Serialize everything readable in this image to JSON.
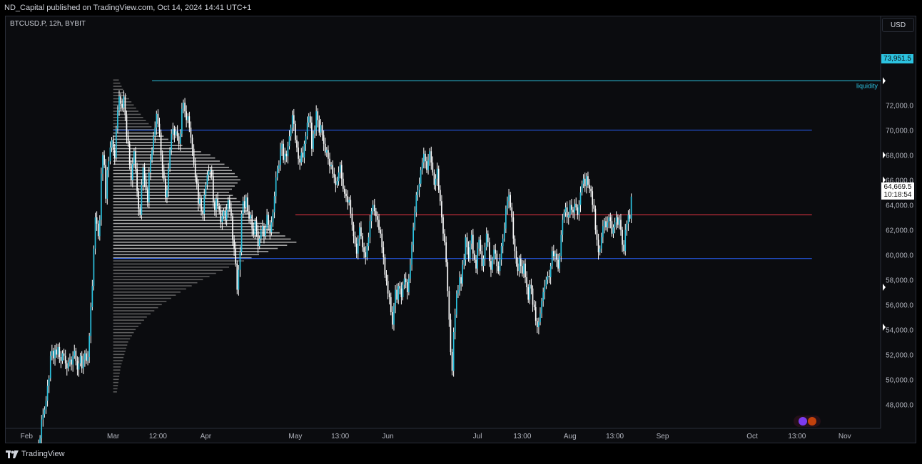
{
  "header": {
    "publish_info": "ND_Capital published on TradingView.com, Oct 14, 2024 14:41 UTC+1"
  },
  "symbol_info": "BTCUSD.P, 12h, BYBIT",
  "currency_label": "USD",
  "footer": {
    "brand": "TradingView"
  },
  "colors": {
    "background": "#0b0c0f",
    "candle": "#2cc3e0",
    "wick": "#ffffff",
    "range_lines": "#2962ff",
    "poc_line": "#f23645",
    "liquidity_line": "#2cc3e0",
    "volume_profile": "#9e9e9e"
  },
  "chart_data": {
    "type": "candlestick",
    "symbol": "BTCUSD.P",
    "timeframe": "12h",
    "exchange": "BYBIT",
    "currency": "USD",
    "ylim": [
      47000,
      75800
    ],
    "y_ticks": [
      48000,
      50000,
      52000,
      54000,
      56000,
      58000,
      60000,
      62000,
      64000,
      66000,
      68000,
      70000,
      72000
    ],
    "y_tick_labels": [
      "48,000.0",
      "50,000.0",
      "52,000.0",
      "54,000.0",
      "56,000.0",
      "58,000.0",
      "60,000.0",
      "62,000.0",
      "64,000.0",
      "66,000.0",
      "68,000.0",
      "70,000.0",
      "72,000.0"
    ],
    "x_ticks": [
      "Feb",
      "Mar",
      "12:00",
      "Apr",
      "May",
      "13:00",
      "Jun",
      "Jul",
      "13:00",
      "Aug",
      "13:00",
      "Sep",
      "Oct",
      "13:00",
      "Nov"
    ],
    "x_tick_dates": [
      "2024-02-01",
      "2024-03-01",
      "2024-03-16",
      "2024-04-01",
      "2024-05-01",
      "2024-05-16",
      "2024-06-01",
      "2024-07-01",
      "2024-07-16",
      "2024-08-01",
      "2024-08-16",
      "2024-09-01",
      "2024-10-01",
      "2024-10-16",
      "2024-11-01"
    ],
    "x_range": [
      "2024-01-25",
      "2024-11-13"
    ],
    "levels": [
      {
        "name": "liquidity",
        "value": 73951.5,
        "label": "liquidity",
        "price_label": "73,951.5",
        "start": "2024-03-14",
        "end": "2024-11-13",
        "color": "#2cc3e0"
      },
      {
        "name": "range_high",
        "value": 70000,
        "start": "2024-03-01",
        "end": "2024-10-21",
        "color": "#2962ff"
      },
      {
        "name": "point_of_control",
        "value": 63200,
        "start": "2024-05-01",
        "end": "2024-10-21",
        "color": "#f23645"
      },
      {
        "name": "range_low",
        "value": 59700,
        "start": "2024-03-01",
        "end": "2024-10-21",
        "color": "#2962ff"
      }
    ],
    "last_price": {
      "value": 64669.5,
      "label": "64,669.5",
      "countdown": "10:18:54"
    },
    "volume_profile": {
      "start": "2024-03-01",
      "price_min": 49000,
      "price_max": 74000,
      "value_area_low": 59700,
      "value_area_high": 70000,
      "bucket_prices": [
        49000,
        50000,
        51000,
        52000,
        53000,
        54000,
        55000,
        56000,
        57000,
        58000,
        59000,
        60000,
        61000,
        62000,
        63000,
        64000,
        65000,
        66000,
        67000,
        68000,
        69000,
        70000,
        71000,
        72000,
        73000,
        74000
      ],
      "relative_volume": [
        0.02,
        0.03,
        0.04,
        0.06,
        0.08,
        0.12,
        0.18,
        0.26,
        0.36,
        0.48,
        0.62,
        0.78,
        0.98,
        0.86,
        0.74,
        0.7,
        0.62,
        0.68,
        0.62,
        0.52,
        0.32,
        0.22,
        0.16,
        0.11,
        0.06,
        0.03
      ]
    },
    "candles": {
      "start": "2024-02-01",
      "interval_hours": 12,
      "close": [
        42500,
        42800,
        43100,
        42900,
        43400,
        43200,
        43600,
        44100,
        44700,
        45300,
        46800,
        47200,
        47600,
        48300,
        49500,
        50100,
        51900,
        52300,
        51700,
        52400,
        52000,
        52600,
        51800,
        51500,
        52100,
        51900,
        51300,
        50900,
        51400,
        51600,
        51200,
        51900,
        52300,
        51500,
        50800,
        51300,
        51900,
        50900,
        51600,
        52100,
        51500,
        51800,
        53500,
        55800,
        57500,
        60500,
        63000,
        62500,
        61500,
        62800,
        66500,
        68000,
        67200,
        64500,
        66800,
        67500,
        68600,
        69200,
        68400,
        67800,
        70100,
        71600,
        72700,
        72100,
        71800,
        72700,
        71200,
        69500,
        68900,
        67200,
        66000,
        67300,
        68300,
        66900,
        65100,
        63700,
        63200,
        65600,
        67000,
        66000,
        65200,
        64200,
        66600,
        67600,
        68400,
        69500,
        70200,
        71300,
        70500,
        69800,
        68000,
        66700,
        66100,
        64600,
        65200,
        66900,
        68400,
        69700,
        70100,
        69600,
        69900,
        69500,
        68900,
        69700,
        71700,
        72200,
        71500,
        70800,
        71100,
        70200,
        69400,
        68500,
        67300,
        66200,
        65700,
        64100,
        64500,
        63500,
        63300,
        64800,
        65600,
        66400,
        66700,
        66800,
        66300,
        64200,
        63600,
        64500,
        63900,
        63600,
        62600,
        63100,
        63500,
        62800,
        63600,
        64400,
        63700,
        63100,
        61200,
        60500,
        59300,
        57200,
        58800,
        60200,
        63300,
        64300,
        63800,
        64600,
        63500,
        62900,
        63200,
        62100,
        61600,
        62700,
        61900,
        60700,
        61300,
        62000,
        62300,
        61500,
        62100,
        63200,
        62400,
        61800,
        62600,
        63400,
        64700,
        66200,
        66900,
        67200,
        68500,
        68900,
        67600,
        68100,
        67900,
        68700,
        69500,
        70200,
        71200,
        70500,
        69200,
        68600,
        67700,
        67400,
        68200,
        67800,
        68900,
        69500,
        70600,
        71100,
        70600,
        68500,
        69700,
        70000,
        71500,
        70800,
        69800,
        70400,
        69600,
        68900,
        68200,
        68400,
        67700,
        67100,
        67200,
        66500,
        66200,
        65600,
        65900,
        66600,
        67200,
        66100,
        65300,
        64900,
        64700,
        64200,
        64400,
        63300,
        62400,
        61500,
        60900,
        60100,
        61300,
        62200,
        61500,
        60600,
        60200,
        59800,
        60700,
        61400,
        62700,
        63500,
        64000,
        63500,
        63100,
        62800,
        62000,
        61700,
        60600,
        59800,
        58400,
        57900,
        56900,
        56600,
        55400,
        54400,
        55900,
        57200,
        56400,
        57500,
        57300,
        56600,
        57600,
        58100,
        57800,
        57000,
        58100,
        59200,
        60800,
        62200,
        63400,
        64800,
        65200,
        65700,
        66800,
        67400,
        68100,
        67500,
        66800,
        67600,
        68300,
        67400,
        66600,
        65600,
        66100,
        66900,
        65200,
        64300,
        63000,
        61700,
        61000,
        59400,
        57100,
        54800,
        52200,
        50700,
        53800,
        55200,
        56900,
        57200,
        58200,
        57700,
        59200,
        59600,
        61400,
        60600,
        59700,
        60900,
        61600,
        60100,
        59600,
        58900,
        60500,
        61200,
        60300,
        59100,
        59700,
        60600,
        61700,
        61000,
        59500,
        58800,
        59600,
        60400,
        60100,
        59100,
        58700,
        59600,
        60700,
        61300,
        62100,
        63700,
        64300,
        64800,
        63800,
        63000,
        61300,
        60300,
        59300,
        58700,
        59700,
        59100,
        58500,
        59300,
        58200,
        57400,
        56400,
        57600,
        57300,
        56000,
        55800,
        54700,
        54200,
        54600,
        55300,
        56300,
        57000,
        57500,
        58000,
        58300,
        58200,
        59100,
        60300,
        59900,
        60100,
        59600,
        58900,
        59900,
        61600,
        62800,
        63400,
        63800,
        63000,
        63200,
        64000,
        63600,
        63400,
        64100,
        63800,
        63200,
        64000,
        65000,
        65700,
        66100,
        65500,
        66300,
        65600,
        65300,
        65100,
        64000,
        63700,
        62000,
        61200,
        60200,
        60500,
        61400,
        62300,
        62700,
        62200,
        62600,
        63000,
        62700,
        61700,
        62200,
        62600,
        63000,
        62400,
        62800,
        62000,
        60800,
        60300,
        62000,
        62500,
        63200,
        62900,
        64669.5
      ]
    }
  }
}
